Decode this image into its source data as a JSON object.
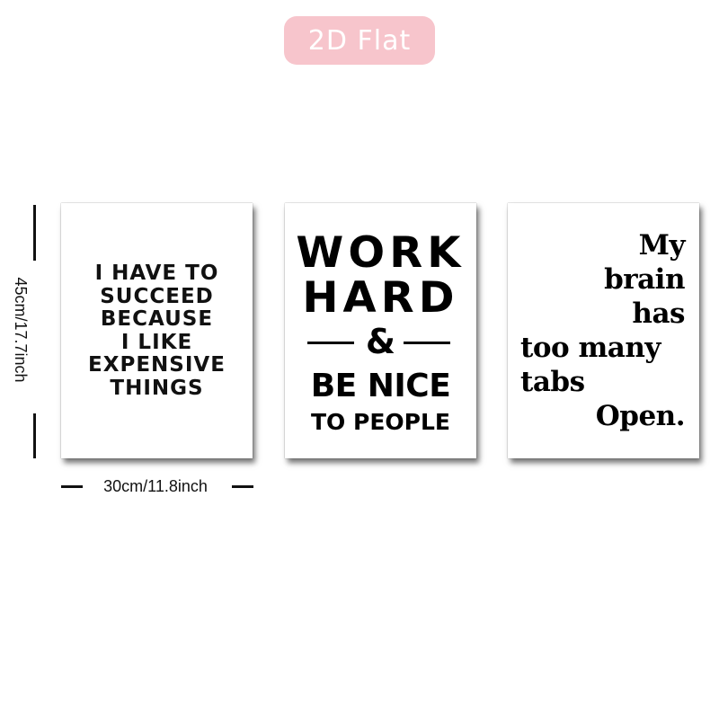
{
  "badge": {
    "label": "2D Flat",
    "background": "#f7c5cc"
  },
  "dimensions": {
    "height_label": "45cm/17.7inch",
    "width_label": "30cm/11.8inch"
  },
  "posters": [
    {
      "lines": [
        "I HAVE TO",
        "SUCCEED",
        "BECAUSE",
        "I LIKE",
        "EXPENSIVE",
        "THINGS"
      ]
    },
    {
      "line1": "WORK",
      "line2": "HARD",
      "ampersand": "&",
      "line3": "BE NICE",
      "line4": "TO PEOPLE"
    },
    {
      "lines": [
        "My",
        "brain",
        "has",
        "too many",
        "tabs",
        "Open."
      ]
    }
  ]
}
